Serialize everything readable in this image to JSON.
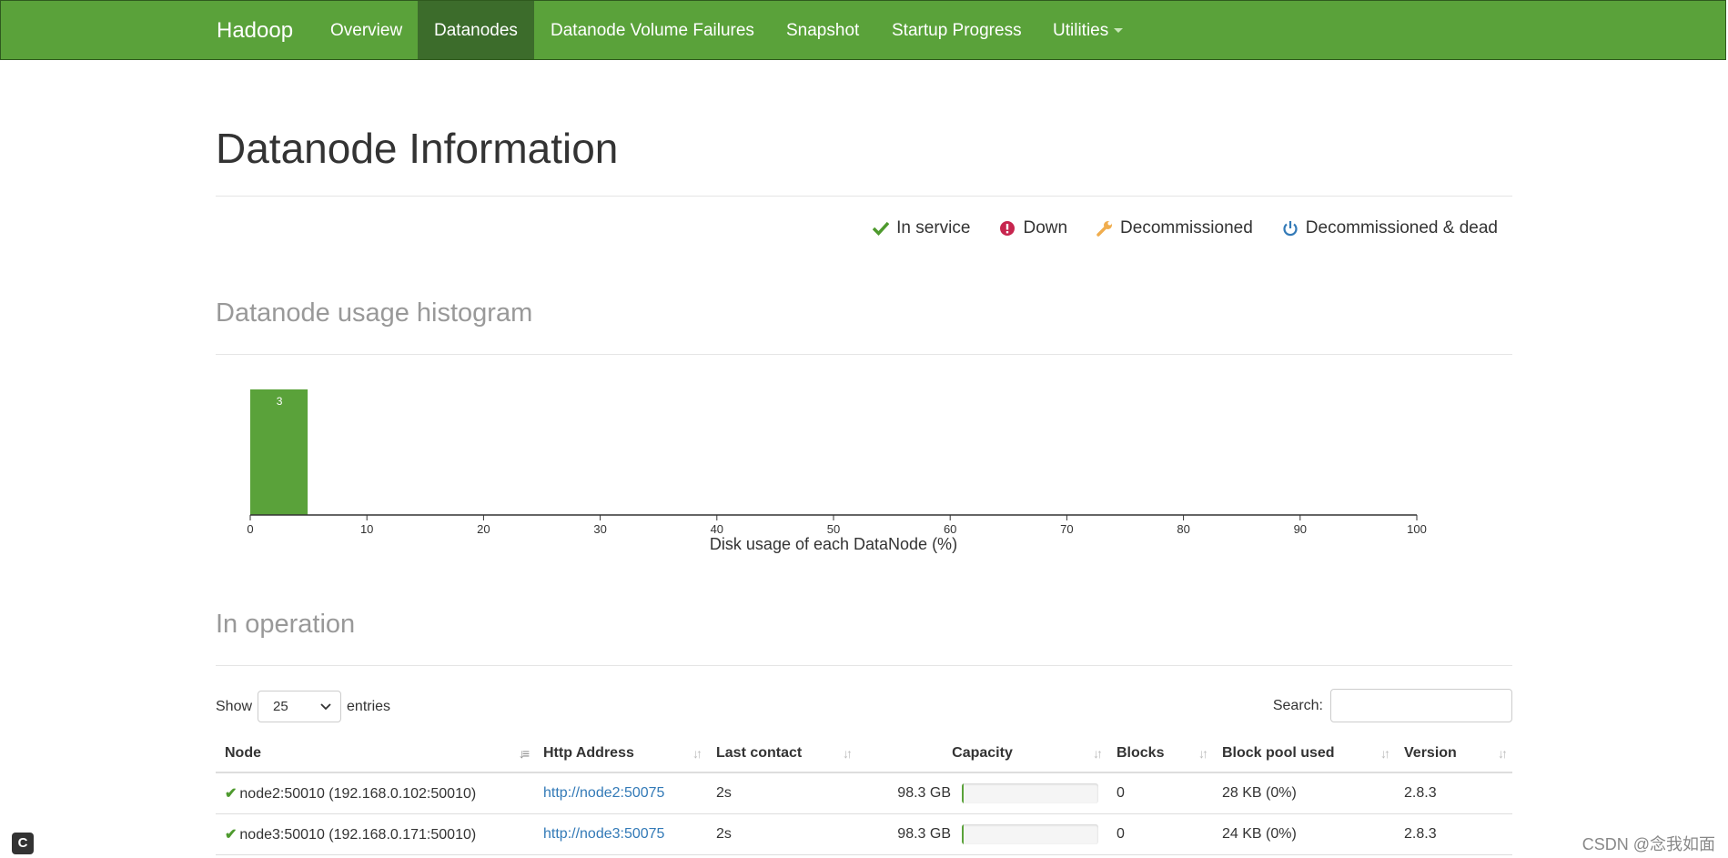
{
  "navbar": {
    "brand": "Hadoop",
    "items": [
      {
        "label": "Overview"
      },
      {
        "label": "Datanodes"
      },
      {
        "label": "Datanode Volume Failures"
      },
      {
        "label": "Snapshot"
      },
      {
        "label": "Startup Progress"
      },
      {
        "label": "Utilities"
      }
    ],
    "active": "Datanodes",
    "color": "#5aa23a",
    "active_color": "#3c6c2b"
  },
  "page_title": "Datanode Information",
  "legend": [
    {
      "icon": "check-icon",
      "label": "In service",
      "color": "#4e9a2e"
    },
    {
      "icon": "exclamation-circle-icon",
      "label": "Down",
      "color": "#c7254e"
    },
    {
      "icon": "wrench-icon",
      "label": "Decommissioned",
      "color": "#f0ad4e"
    },
    {
      "icon": "power-icon",
      "label": "Decommissioned & dead",
      "color": "#337ab7"
    }
  ],
  "histogram_section": {
    "title": "Datanode usage histogram"
  },
  "chart_data": {
    "type": "bar",
    "title": "",
    "xlabel": "Disk usage of each DataNode (%)",
    "ylabel": "",
    "xlim": [
      0,
      100
    ],
    "xticks": [
      0,
      10,
      20,
      30,
      40,
      50,
      60,
      70,
      80,
      90,
      100
    ],
    "bins": [
      {
        "x0": 0,
        "x1": 5,
        "count": 3
      }
    ],
    "bar_color": "#5aa23a",
    "grid": false
  },
  "operation_section": {
    "title": "In operation",
    "show_label": "Show",
    "entries_value": "25",
    "entries_label": "entries",
    "search_label": "Search:",
    "search_value": ""
  },
  "table": {
    "columns": [
      "Node",
      "Http Address",
      "Last contact",
      "Capacity",
      "Blocks",
      "Block pool used",
      "Version"
    ],
    "rows": [
      {
        "node": "node2:50010 (192.168.0.102:50010)",
        "http": "http://node2:50075",
        "last_contact": "2s",
        "capacity": "98.3 GB",
        "capacity_used_fraction": 0.0,
        "blocks": "0",
        "block_pool_used": "28 KB (0%)",
        "version": "2.8.3"
      },
      {
        "node": "node3:50010 (192.168.0.171:50010)",
        "http": "http://node3:50075",
        "last_contact": "2s",
        "capacity": "98.3 GB",
        "capacity_used_fraction": 0.0,
        "blocks": "0",
        "block_pool_used": "24 KB (0%)",
        "version": "2.8.3"
      }
    ]
  },
  "corner_badge": "C",
  "watermark": "CSDN @念我如面"
}
